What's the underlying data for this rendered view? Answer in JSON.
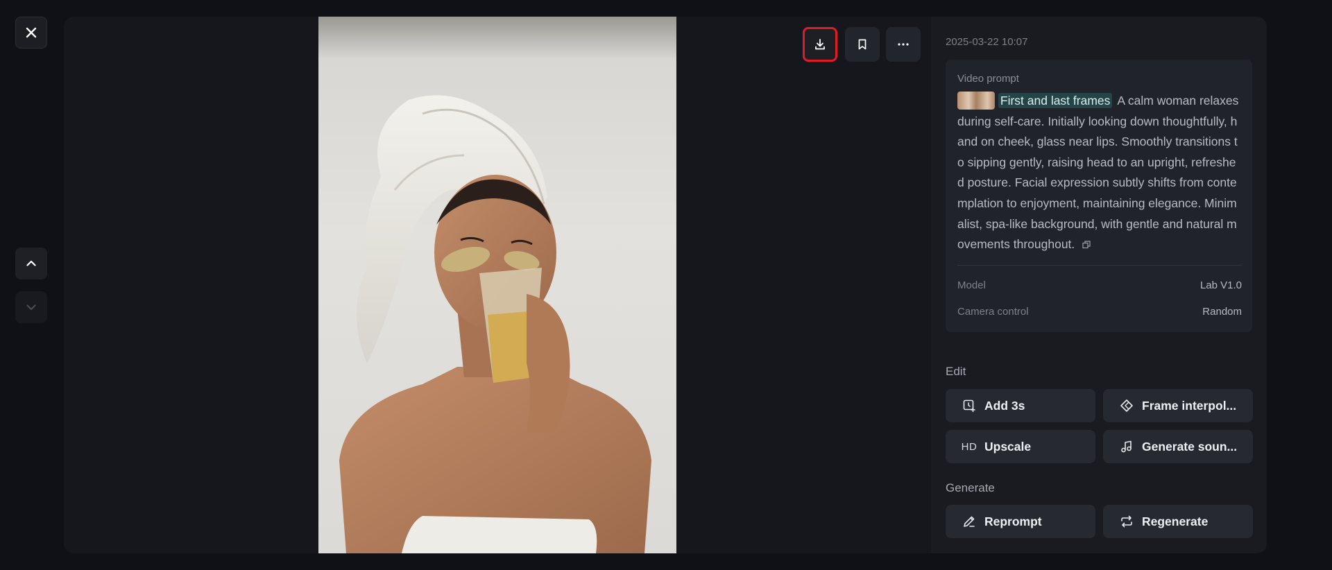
{
  "viewer": {
    "close_label": "close",
    "nav_up_label": "previous",
    "nav_down_label": "next",
    "toolbar": {
      "download": "download-icon",
      "bookmark": "bookmark-icon",
      "more": "more-icon"
    }
  },
  "details": {
    "timestamp": "2025-03-22 10:07",
    "prompt": {
      "label": "Video prompt",
      "tag": "First and last frames",
      "text": "A calm woman relaxes during self-care. Initially looking down thoughtfully, hand on cheek, glass near lips. Smoothly transitions to sipping gently, raising head to an upright, refreshed posture. Facial expression subtly shifts from contemplation to enjoyment, maintaining elegance. Minimalist, spa-like background, with gentle and natural movements throughout."
    },
    "meta": [
      {
        "key": "Model",
        "value": "Lab V1.0"
      },
      {
        "key": "Camera control",
        "value": "Random"
      }
    ]
  },
  "edit": {
    "title": "Edit",
    "buttons": {
      "add": "Add 3s",
      "frame": "Frame interpol...",
      "upscale": "Upscale",
      "upscale_badge": "HD",
      "sound": "Generate soun..."
    }
  },
  "generate": {
    "title": "Generate",
    "buttons": {
      "reprompt": "Reprompt",
      "regenerate": "Regenerate"
    }
  },
  "colors": {
    "highlight": "#e21b26",
    "tag_bg": "#244448",
    "panel_bg": "#191b21"
  }
}
